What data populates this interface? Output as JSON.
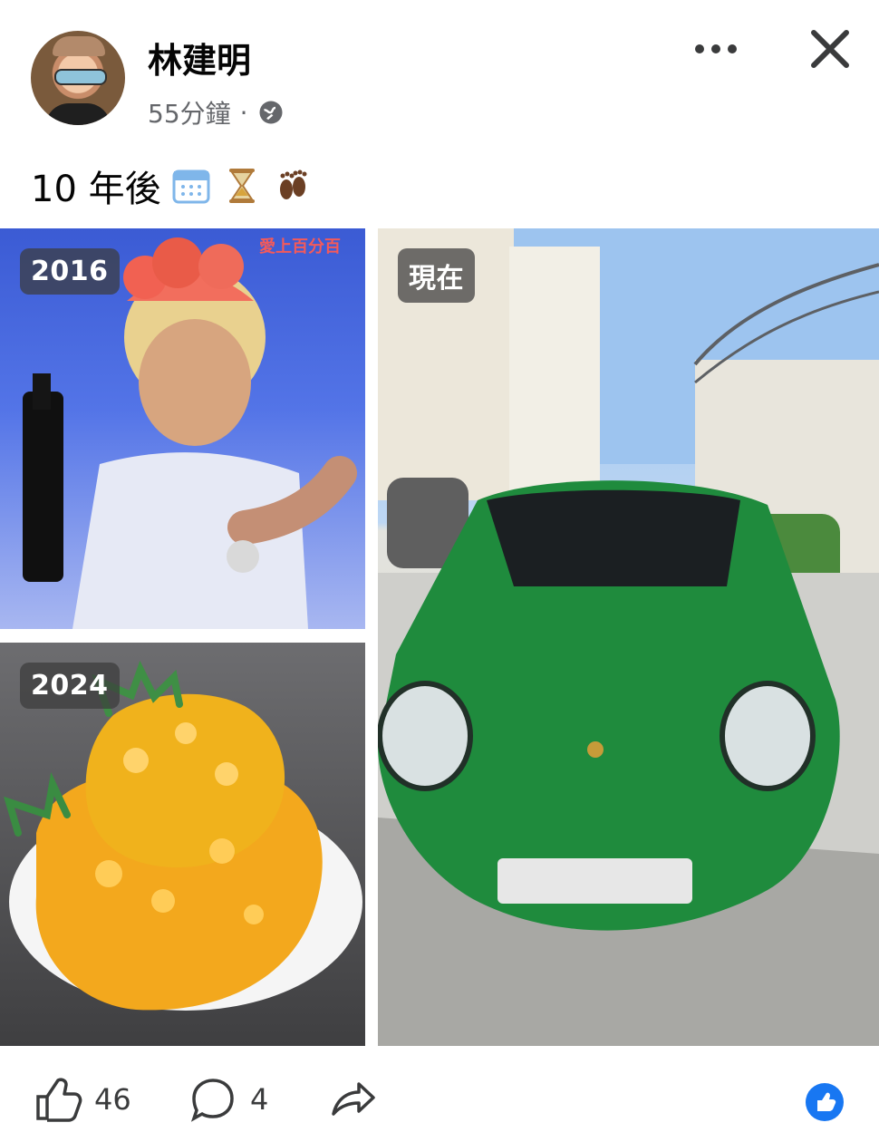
{
  "post": {
    "author": "林建明",
    "time": "55分鐘",
    "separator": "·",
    "caption_text": "10 年後",
    "caption_emojis": [
      "calendar-icon",
      "hourglass-icon",
      "footprints-icon"
    ],
    "media": [
      {
        "label": "2016",
        "subject": "woman-with-headdress-photo"
      },
      {
        "label": "2024",
        "subject": "pineapple-seafood-dish-photo"
      },
      {
        "label": "現在",
        "subject": "green-sports-car-photo"
      }
    ],
    "watermark": "愛上百分百"
  },
  "actions": {
    "like_count": "46",
    "comment_count": "4",
    "share_label": ""
  },
  "colors": {
    "text": "#050505",
    "muted": "#65676b",
    "accent": "#1877f2"
  }
}
